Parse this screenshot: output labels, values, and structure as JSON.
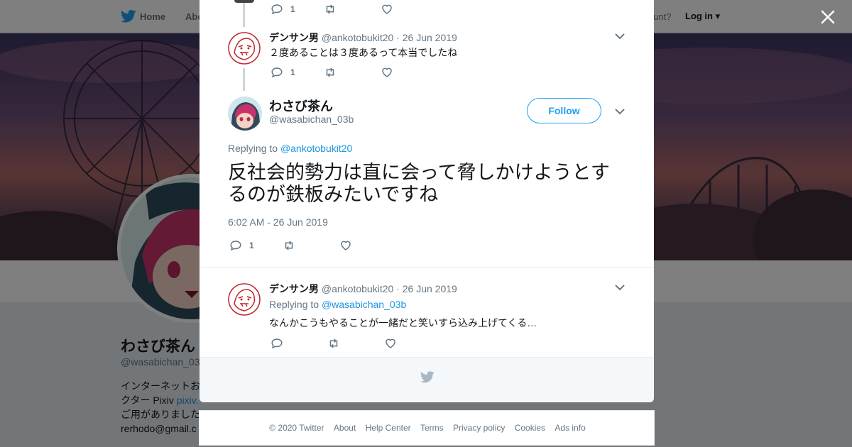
{
  "nav": {
    "home": "Home",
    "about": "Abo",
    "have_account": "ccount?",
    "login": "Log in"
  },
  "profile": {
    "name": "わさび茶ん",
    "handle": "@wasabichan_03",
    "bio_line1": "インターネットお",
    "bio_line2_prefix": "クター Pixiv ",
    "bio_line2_link": "pixiv.",
    "bio_line3": "ご用がありました",
    "bio_line4": "rerhodo@gmail.c"
  },
  "thread": {
    "top_actions": {
      "reply_count": "1"
    },
    "parent": {
      "name": "デンサン男",
      "handle": "@ankotobukit20",
      "sep": "·",
      "date": "26 Jun 2019",
      "text": "２度あることは３度あるって本当でしたね",
      "reply_count": "1"
    },
    "main": {
      "name": "わさび茶ん",
      "handle": "@wasabichan_03b",
      "follow_label": "Follow",
      "replying_prefix": "Replying to ",
      "replying_to": "@ankotobukit20",
      "text": "反社会的勢力は直に会って脅しかけようとするのが鉄板みたいですね",
      "timestamp": "6:02 AM - 26 Jun 2019",
      "reply_count": "1"
    },
    "reply": {
      "name": "デンサン男",
      "handle": "@ankotobukit20",
      "sep": "·",
      "date": "26 Jun 2019",
      "replying_prefix": "Replying to ",
      "replying_to": "@wasabichan_03b",
      "text": "なんかこうもやることが一緒だと笑いすら込み上げてくる…"
    }
  },
  "footer": {
    "copyright": "© 2020 Twitter",
    "about": "About",
    "help": "Help Center",
    "terms": "Terms",
    "privacy": "Privacy policy",
    "cookies": "Cookies",
    "ads": "Ads info"
  },
  "icons": {
    "twitter_bird": "twitter-bird-icon",
    "reply": "reply-icon",
    "retweet": "retweet-icon",
    "like": "heart-icon",
    "caret": "chevron-down-icon",
    "close": "close-icon"
  },
  "colors": {
    "accent": "#1da1f2",
    "link": "#1b95e0",
    "muted": "#657786",
    "thread_line": "#ccd6dd"
  }
}
